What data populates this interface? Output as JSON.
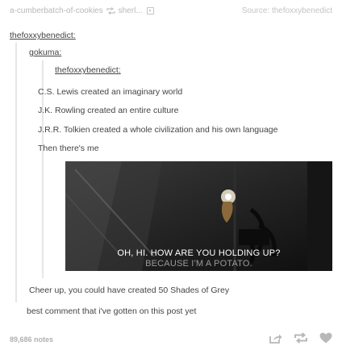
{
  "header": {
    "reblogged_from": "a-cumberbatch-of-cookies",
    "reblog_via": "sherl...",
    "source_label": "Source: thefoxxybenedict"
  },
  "thread": {
    "level0_user": "thefoxxybenedict:",
    "level1_user": "gokuma:",
    "level2_user": "thefoxxybenedict:",
    "level2_lines": [
      "C.S. Lewis created an imaginary world",
      "J.K. Rowling created an entire culture",
      "J.R.R. Tolkien created a whole civilization and his own language",
      "Then there's me"
    ],
    "video_subtitle_line1": "OH, HI. HOW ARE YOU HOLDING UP?",
    "video_subtitle_line2": "BECAUSE I'M A POTATO.",
    "level1_reply": "Cheer up, you could have created 50 Shades of Grey",
    "level0_reply": "best comment that i've gotten on this post yet"
  },
  "footer": {
    "notes": "89,686 notes"
  },
  "icons": {
    "reblog": "reblog-icon",
    "share": "share-icon",
    "like": "heart-icon"
  },
  "colors": {
    "text": "#444444",
    "muted": "#b8b8b8",
    "quote_border": "#e6e6e6"
  }
}
